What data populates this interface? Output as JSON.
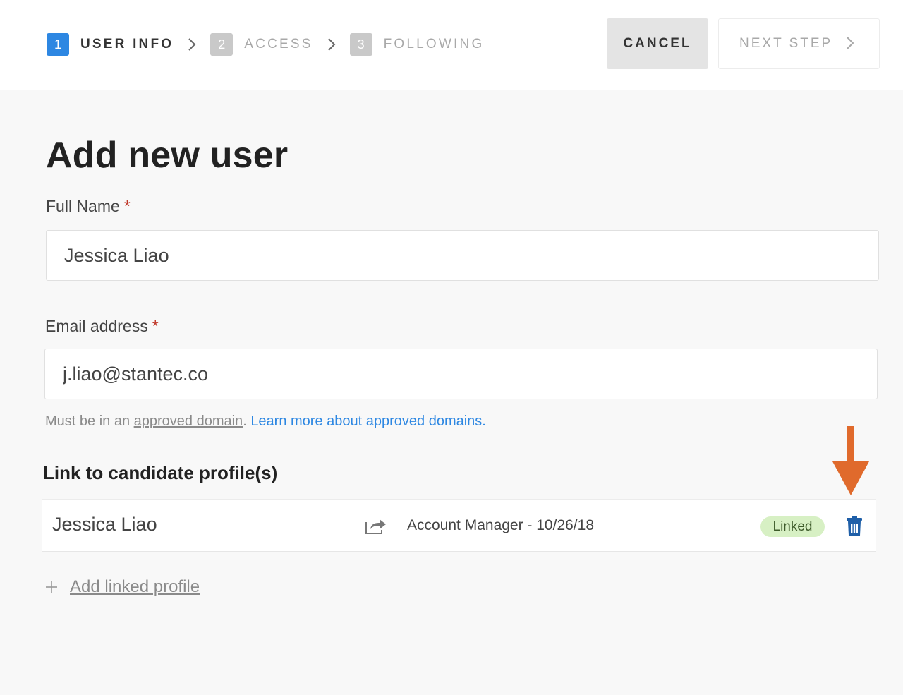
{
  "wizard": {
    "steps": [
      {
        "number": "1",
        "label": "USER INFO",
        "state": "active"
      },
      {
        "number": "2",
        "label": "ACCESS",
        "state": "inactive"
      },
      {
        "number": "3",
        "label": "FOLLOWING",
        "state": "inactive"
      }
    ],
    "cancel_label": "CANCEL",
    "next_label": "NEXT STEP"
  },
  "page": {
    "title": "Add new user"
  },
  "form": {
    "full_name": {
      "label": "Full Name",
      "required_mark": "*",
      "value": "Jessica Liao"
    },
    "email": {
      "label": "Email address",
      "required_mark": "*",
      "value": "j.liao@stantec.co"
    },
    "help": {
      "prefix": "Must be in an ",
      "domain_link": "approved domain",
      "separator": ". ",
      "learn_more": "Learn more about approved domains."
    }
  },
  "candidates": {
    "section_title": "Link to candidate profile(s)",
    "profiles": [
      {
        "name": "Jessica Liao",
        "job": "Account Manager - 10/26/18",
        "status": "Linked"
      }
    ],
    "add_label": "Add linked profile"
  },
  "colors": {
    "accent": "#2d87e2",
    "linked_badge": "#d7f0c4",
    "trash_icon": "#1f5fa8",
    "annotation_arrow": "#e06a2c"
  },
  "icons": {
    "step_separator": "chevron-right-icon",
    "next": "chevron-right-icon",
    "profile_link": "share-arrow-icon",
    "remove": "trash-icon",
    "add": "plus-icon",
    "annotation": "arrow-down-icon"
  }
}
